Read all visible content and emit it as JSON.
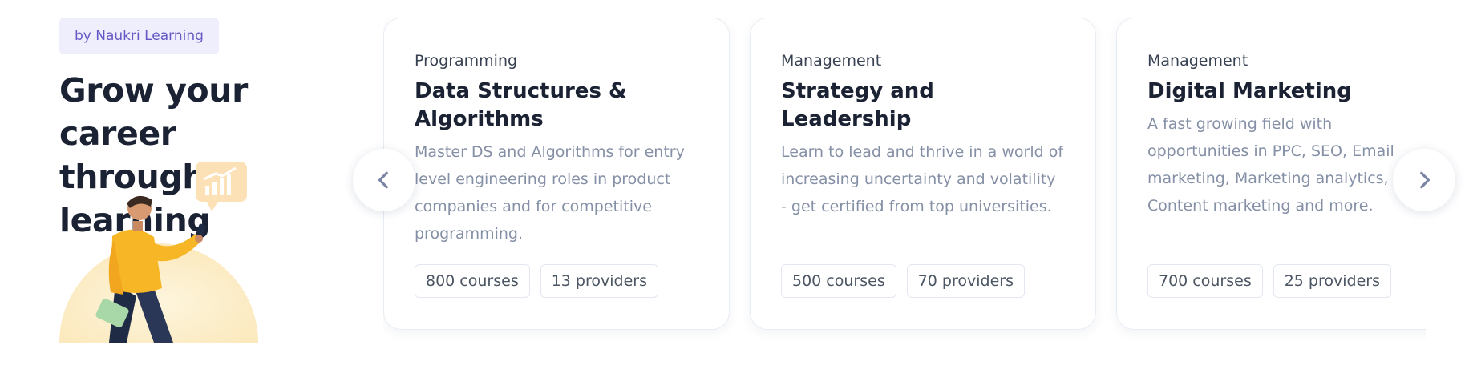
{
  "hero": {
    "badge": "by Naukri Learning",
    "headline_line1": "Grow your career",
    "headline_line2": "through learning"
  },
  "cards": [
    {
      "category": "Programming",
      "title": "Data Structures & Algorithms",
      "description": "Master DS and Algorithms for entry level engineering roles in product companies and for competitive programming.",
      "courses": "800 courses",
      "providers": "13 providers"
    },
    {
      "category": "Management",
      "title": "Strategy and Leadership",
      "description": "Learn to lead and thrive in a world of increasing uncertainty and volatility - get certified from top universities.",
      "courses": "500 courses",
      "providers": "70 providers"
    },
    {
      "category": "Management",
      "title": "Digital Marketing",
      "description": "A fast growing field with opportunities in PPC, SEO, Email marketing, Marketing analytics, Content marketing and more.",
      "courses": "700 courses",
      "providers": "25 providers"
    }
  ],
  "icons": {
    "prev": "chevron-left-icon",
    "next": "chevron-right-icon",
    "chart_bubble": "bar-chart-icon"
  },
  "colors": {
    "badge_bg": "#eeeefc",
    "badge_text": "#6558c4",
    "nav_arrow": "#7d86a6",
    "illustration_sun": "#fdf0cf",
    "shirt": "#f7b626"
  }
}
